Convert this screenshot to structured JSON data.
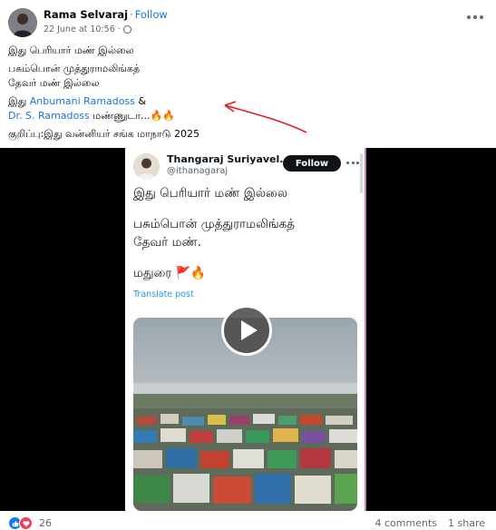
{
  "post": {
    "author": "Rama Selvaraj",
    "separator": "·",
    "follow_label": "Follow",
    "timestamp": "22 June at 10:56",
    "caption_line1": "இது பெரியார் மண் இல்லை",
    "caption_line2": "பசும்பொன் முத்துராமலிங்கத்",
    "caption_line3": "தேவர் மண் இல்லை",
    "caption_prefix": "இது",
    "mention1": "Anbumani Ramadoss",
    "amp": "&",
    "mention2": "Dr. S. Ramadoss",
    "caption_suffix": "மண்ணுடா...",
    "fire_emoji": "🔥🔥",
    "caption_note": "குறிப்பு:இது வன்னியர் சங்க மாநாடு 2025"
  },
  "embedded_tweet": {
    "name": "Thangaraj Suriyavel...",
    "handle": "@ithanagaraj",
    "follow_label": "Follow",
    "line1": "இது பெரியார் மண் இல்லை",
    "line2": "பசும்பொன் முத்துராமலிங்கத்",
    "line3": "தேவர் மண்.",
    "line4": "மதுரை",
    "emojis": "🚩🔥",
    "translate_label": "Translate post"
  },
  "footer": {
    "reaction_count": "26",
    "comments": "4 comments",
    "shares": "1 share"
  },
  "icons": {
    "like": "like-reaction-icon",
    "love": "love-reaction-icon",
    "play": "play-icon",
    "more": "more-options-icon",
    "globe": "globe-icon"
  },
  "colors": {
    "link": "#1b74e4",
    "annotation": "#e02020",
    "twitter_link": "#1d9bf0",
    "like_blue": "#1877f2",
    "love_red": "#f33e58"
  }
}
